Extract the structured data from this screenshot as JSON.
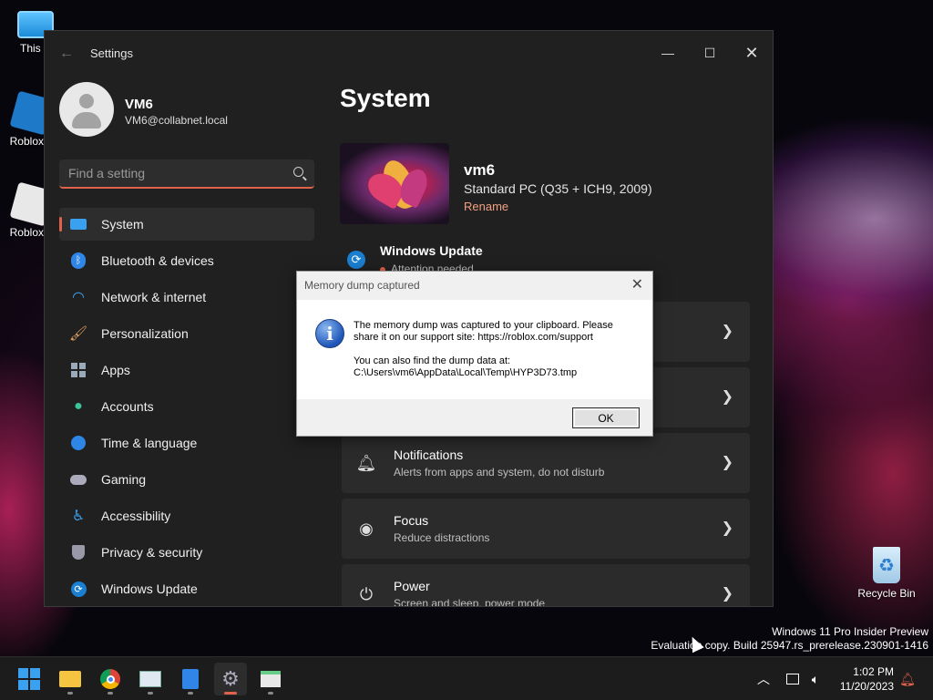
{
  "desktop": {
    "icons": [
      {
        "label": "This P",
        "icon": "monitor-icon"
      },
      {
        "label": "Roblox S",
        "icon": "roblox-studio-icon"
      },
      {
        "label": "Roblox P",
        "icon": "roblox-player-icon"
      },
      {
        "label": "Recycle Bin",
        "icon": "recycle-bin-icon"
      }
    ]
  },
  "settings": {
    "app_title": "Settings",
    "user": {
      "name": "VM6",
      "email": "VM6@collabnet.local"
    },
    "search_placeholder": "Find a setting",
    "nav": [
      {
        "label": "System",
        "icon": "system-icon",
        "active": true
      },
      {
        "label": "Bluetooth & devices",
        "icon": "bluetooth-icon"
      },
      {
        "label": "Network & internet",
        "icon": "wifi-icon"
      },
      {
        "label": "Personalization",
        "icon": "brush-icon"
      },
      {
        "label": "Apps",
        "icon": "apps-icon"
      },
      {
        "label": "Accounts",
        "icon": "person-icon"
      },
      {
        "label": "Time & language",
        "icon": "globe-clock-icon"
      },
      {
        "label": "Gaming",
        "icon": "gamepad-icon"
      },
      {
        "label": "Accessibility",
        "icon": "accessibility-icon"
      },
      {
        "label": "Privacy & security",
        "icon": "shield-icon"
      },
      {
        "label": "Windows Update",
        "icon": "update-icon"
      }
    ],
    "page_title": "System",
    "device": {
      "name": "vm6",
      "model": "Standard PC (Q35 + ICH9, 2009)",
      "rename": "Rename"
    },
    "windows_update": {
      "title": "Windows Update",
      "status": "Attention needed"
    },
    "cards": [
      {
        "title": "Notifications",
        "subtitle": "Alerts from apps and system, do not disturb",
        "icon": "bell-icon"
      },
      {
        "title": "Focus",
        "subtitle": "Reduce distractions",
        "icon": "focus-icon"
      },
      {
        "title": "Power",
        "subtitle": "Screen and sleep, power mode",
        "icon": "power-icon"
      }
    ]
  },
  "dialog": {
    "title": "Memory dump captured",
    "message1": "The memory dump was captured to your clipboard. Please\nshare it on our support site: https://roblox.com/support",
    "message2": "You can also find the dump data at:\nC:\\Users\\vm6\\AppData\\Local\\Temp\\HYP3D73.tmp",
    "ok": "OK"
  },
  "watermark": {
    "line1": "Windows 11 Pro Insider Preview",
    "line2": "Evaluation copy. Build 25947.rs_prerelease.230901-1416"
  },
  "taskbar": {
    "apps": [
      "start-icon",
      "file-explorer-icon",
      "chrome-icon",
      "task-manager-icon",
      "notepad-icon",
      "settings-icon",
      "app-window-icon"
    ],
    "time": "1:02 PM",
    "date": "11/20/2023"
  },
  "colors": {
    "accent": "#e0624a",
    "window_bg": "#202020",
    "card_bg": "#2b2b2b"
  }
}
